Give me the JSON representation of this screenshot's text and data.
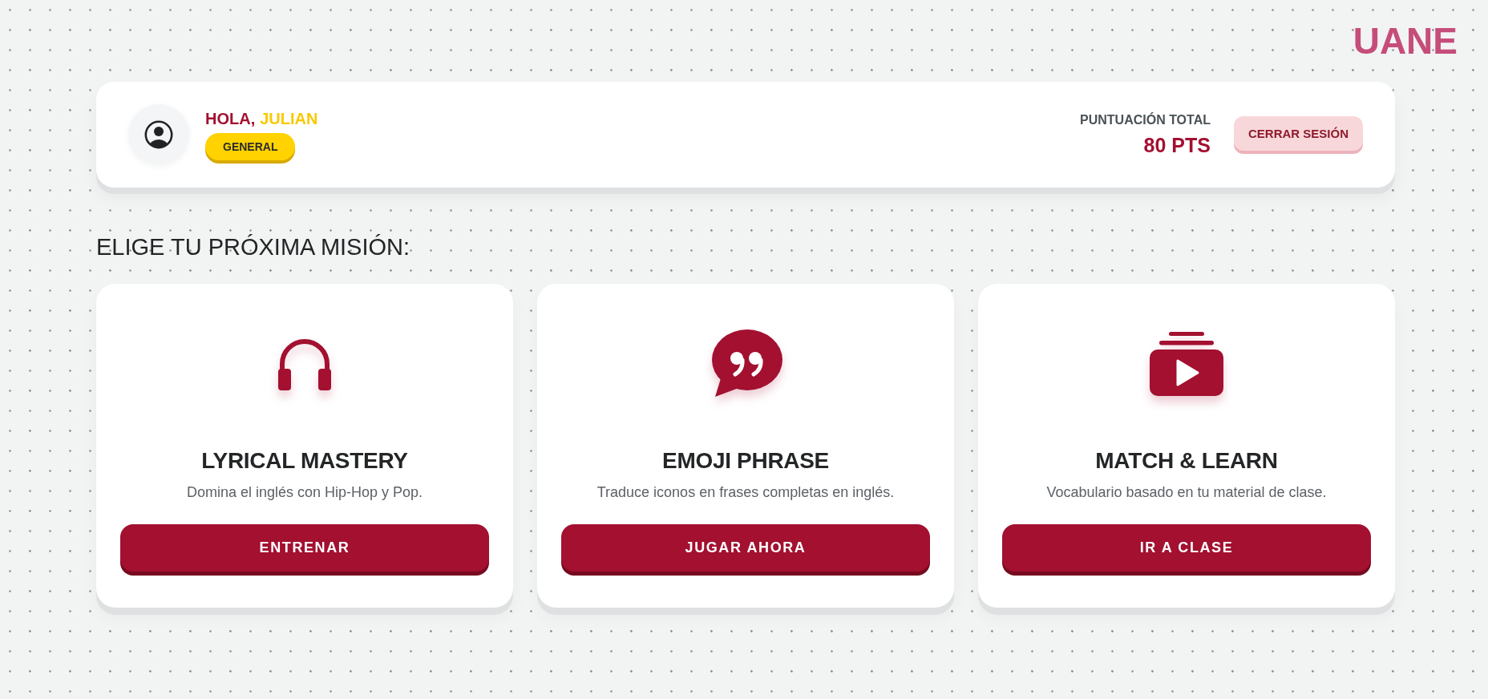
{
  "logo": {
    "text": "UANE"
  },
  "header": {
    "greeting": "HOLA,",
    "user_name": "JULIAN",
    "badge": "GENERAL",
    "score_label": "PUNTUACIÓN TOTAL",
    "score": "80 PTS",
    "logout_button": "CERRAR SESIÓN"
  },
  "section_title": "ELIGE TU PRÓXIMA MISIÓN:",
  "missions": [
    {
      "kind": "headphones",
      "title": "LYRICAL MASTERY",
      "description": "Domina el inglés con Hip-Hop y Pop.",
      "button": "ENTRENAR"
    },
    {
      "kind": "quote",
      "title": "EMOJI PHRASE",
      "description": "Traduce iconos en frases completas en inglés.",
      "button": "JUGAR AHORA"
    },
    {
      "kind": "video",
      "title": "MATCH & LEARN",
      "description": "Vocabulario basado en tu material de clase.",
      "button": "IR A CLASE"
    }
  ]
}
